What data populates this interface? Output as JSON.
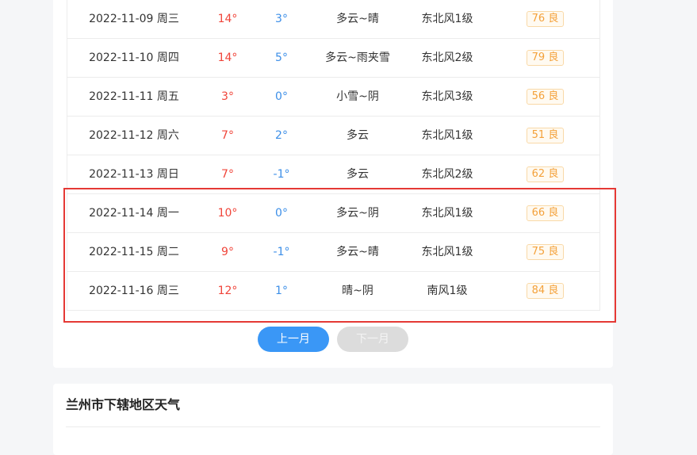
{
  "rows": [
    {
      "date": "2022-11-09 周三",
      "high": "14°",
      "low": "3°",
      "weather": "多云~晴",
      "wind": "东北风1级",
      "aqi": "76 良"
    },
    {
      "date": "2022-11-10 周四",
      "high": "14°",
      "low": "5°",
      "weather": "多云~雨夹雪",
      "wind": "东北风2级",
      "aqi": "79 良"
    },
    {
      "date": "2022-11-11 周五",
      "high": "3°",
      "low": "0°",
      "weather": "小雪~阴",
      "wind": "东北风3级",
      "aqi": "56 良"
    },
    {
      "date": "2022-11-12 周六",
      "high": "7°",
      "low": "2°",
      "weather": "多云",
      "wind": "东北风1级",
      "aqi": "51 良"
    },
    {
      "date": "2022-11-13 周日",
      "high": "7°",
      "low": "-1°",
      "weather": "多云",
      "wind": "东北风2级",
      "aqi": "62 良"
    },
    {
      "date": "2022-11-14 周一",
      "high": "10°",
      "low": "0°",
      "weather": "多云~阴",
      "wind": "东北风1级",
      "aqi": "66 良"
    },
    {
      "date": "2022-11-15 周二",
      "high": "9°",
      "low": "-1°",
      "weather": "多云~晴",
      "wind": "东北风1级",
      "aqi": "75 良"
    },
    {
      "date": "2022-11-16 周三",
      "high": "12°",
      "low": "1°",
      "weather": "晴~阴",
      "wind": "南风1级",
      "aqi": "84 良"
    }
  ],
  "pagination": {
    "prev_label": "上一月",
    "next_label": "下一月"
  },
  "section2": {
    "title": "兰州市下辖地区天气"
  },
  "colors": {
    "high_temp": "#f0453a",
    "low_temp": "#3d8fe8",
    "aqi_good": "#f4a13a",
    "accent": "#3a97f6",
    "highlight_box": "#e53935"
  }
}
